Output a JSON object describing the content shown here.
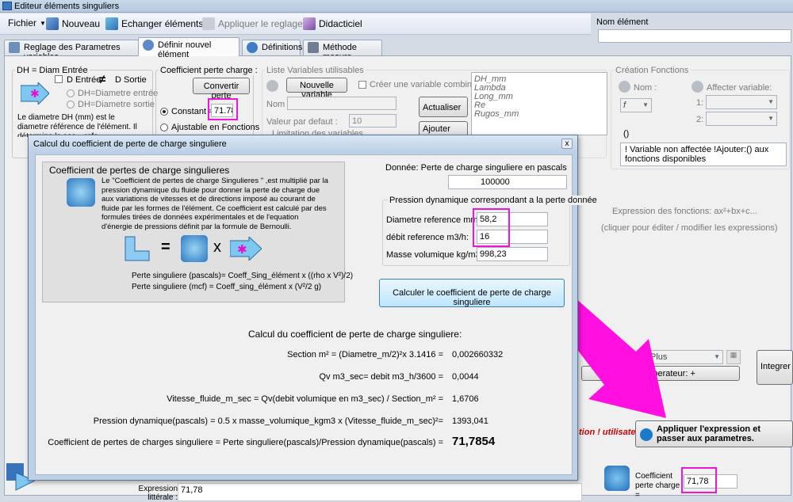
{
  "window": {
    "title": "Editeur éléments singuliers"
  },
  "menu": {
    "fichier": "Fichier",
    "nouveau": "Nouveau",
    "echanger": "Echanger éléments",
    "appliquer": "Appliquer le reglage",
    "didacticiel": "Didacticiel"
  },
  "nom_element": {
    "label": "Nom élément",
    "value": ""
  },
  "tabs": [
    "Reglage des Parametres variables",
    "Définir nouvel élément",
    "Définitions",
    "Méthode  mesure"
  ],
  "dh": {
    "title": "DH = Diam Entrée",
    "d_entree": "D Entrée",
    "neq": "≠",
    "d_sortie": "D Sortie",
    "opt1": "DH=Diametre entrée",
    "opt2": "DH=Diametre sortie",
    "desc": "Le diametre DH (mm) est le diametre référence de l'élément. Il détermine la sec... refe..."
  },
  "coeff_group": {
    "title": "Coefficient perte charge :",
    "convertir": "Convertir perte",
    "constant_label": "Constant =",
    "constant_value": "71.78",
    "ajustable": "Ajustable en Fonctions"
  },
  "liste_vars": {
    "title": "Liste Variables utilisables",
    "nouvelle": "Nouvelle variable",
    "creer": "Créer une variable combinée",
    "nom_label": "Nom :",
    "defaut_label": "Valeur par defaut :",
    "defaut_value": "10",
    "limitation": "Limitation des variables",
    "actualiser": "Actualiser",
    "ajouter": "Ajouter",
    "vars": [
      "DH_mm",
      "Lambda",
      "Long_mm",
      "Re",
      "Rugos_mm"
    ]
  },
  "creation": {
    "title": "Création Fonctions",
    "nom": "Nom :",
    "affecter": "Affecter variable:",
    "f_value": "f",
    "slot1": "1:",
    "slot2": "2:",
    "paren": "()",
    "note": "! Variable non affectée !Ajouter:() aux fonctions disponibles"
  },
  "expression": {
    "title": "Expression des fonctions: ax²+bx+c...",
    "hint": "(cliquer pour éditer / modifier les expressions)",
    "plus": "Plus",
    "inserer": "sérer operateur: +",
    "integrer": "Integrer Co... Frottement...",
    "warning": "tion ! utilisateurs !",
    "apply_btn": "Appliquer l'expression et passer aux parametres."
  },
  "bottom": {
    "coeff_label": "Coefficient perte charge =",
    "coeff_value": "71,78",
    "expr_label": "Expression littérale :",
    "expr_value": "71,78"
  },
  "dialog": {
    "title": "Calcul du coefficient de perte de charge singuliere",
    "close": "x",
    "coeff_box": {
      "title": "Coefficient de pertes de charge singulieres",
      "text": "Le \"Coefficient de pertes de charge Singulieres \" ,est multiplié par la pression dynamique du fluide pour donner la perte de charge due aux variations de vitesses et de directions imposé au courant de fluide par les formes de l'élément. Ce coefficient est calculé par des formules tirées de données expérimentales et de l'equation d'énergie de pressions définit par la formule de Bernoulli.",
      "eq": "=",
      "times": "x",
      "f1": "Perte singuliere (pascals)= Coeff_Sing_élément x ((rho x V²)/2)",
      "f2": "Perte singuliere (mcf) = Coeff_sing_élément x (V²/2 g)"
    },
    "donnee": {
      "title": "Donnée: Perte de charge singuliere en pascals",
      "value": "100000"
    },
    "pression": {
      "title": "Pression dynamique correspondant a la perte donnée",
      "diam_label": "Diametre reference mm:",
      "diam_value": "58,2",
      "debit_label": "débit reference m3/h:",
      "debit_value": "16",
      "masse_label": "Masse volumique kg/m3:",
      "masse_value": "998,23"
    },
    "calc_button": "Calculer le coefficient de perte de charge singuliere",
    "results": {
      "title": "Calcul du coefficient de perte de charge singuliere:",
      "rows": [
        {
          "f": "Section m² = (Diametre_m/2)²x 3.1416 =",
          "v": "0,002660332"
        },
        {
          "f": "Qv m3_sec= debit m3_h/3600 =",
          "v": "0,0044"
        },
        {
          "f": "Vitesse_fluide_m_sec =  Qv(debit volumique en m3_sec) / Section_m² =",
          "v": "1,6706"
        },
        {
          "f": "Pression dynamique(pascals) = 0.5 x masse_volumique_kgm3  x (Vitesse_fluide_m_sec)²=",
          "v": "1393,041"
        }
      ],
      "final_label": "Coefficient de pertes de charges singuliere =  Perte singuliere(pascals)/Pression dynamique(pascals) =",
      "final_value": "71,7854"
    }
  },
  "colors": {
    "highlight": "#ee17d8",
    "arrow": "#ff10e0"
  }
}
